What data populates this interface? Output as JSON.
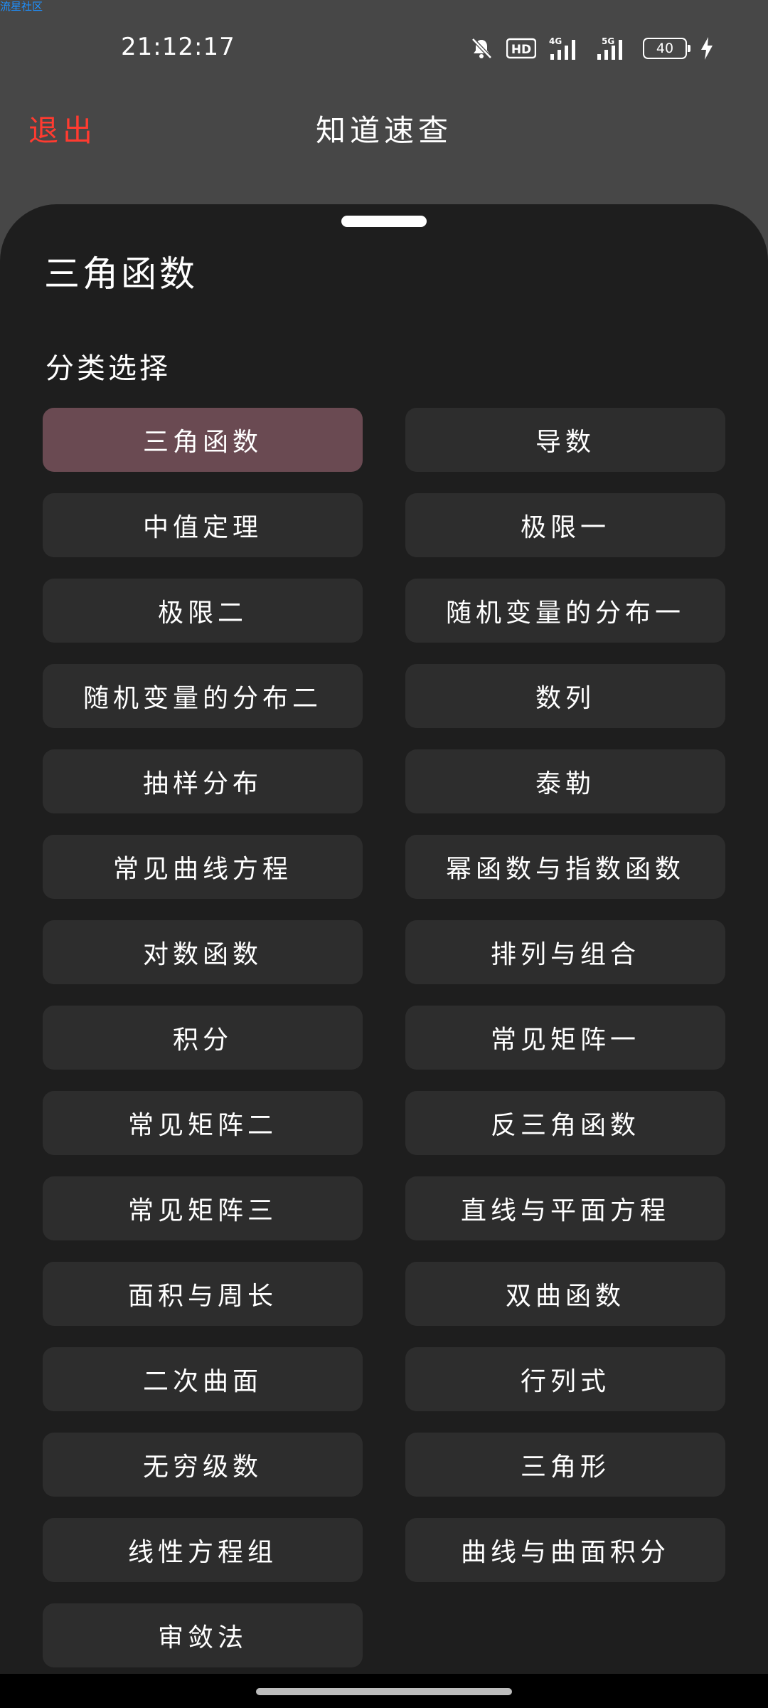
{
  "watermark": "流星社区",
  "status_bar": {
    "time": "21:12:17",
    "battery": "40",
    "icons": [
      "bell-off-icon",
      "hd-icon",
      "signal-4g-icon",
      "signal-5g-icon",
      "battery-icon",
      "charging-bolt-icon"
    ],
    "network_labels": [
      "HD",
      "4G",
      "5G"
    ]
  },
  "header": {
    "exit_label": "退出",
    "title": "知道速查"
  },
  "sheet": {
    "title": "三角函数",
    "section_label": "分类选择",
    "selected_index": 0,
    "categories": [
      "三角函数",
      "导数",
      "中值定理",
      "极限一",
      "极限二",
      "随机变量的分布一",
      "随机变量的分布二",
      "数列",
      "抽样分布",
      "泰勒",
      "常见曲线方程",
      "幂函数与指数函数",
      "对数函数",
      "排列与组合",
      "积分",
      "常见矩阵一",
      "常见矩阵二",
      "反三角函数",
      "常见矩阵三",
      "直线与平面方程",
      "面积与周长",
      "双曲函数",
      "二次曲面",
      "行列式",
      "无穷级数",
      "三角形",
      "线性方程组",
      "曲线与曲面积分",
      "审敛法"
    ]
  },
  "colors": {
    "background": "#474747",
    "sheet": "#1e1e1e",
    "chip": "#2d2d2d",
    "chip_selected": "#6a4a52",
    "exit": "#ff3b30",
    "watermark": "#1e90ff"
  }
}
